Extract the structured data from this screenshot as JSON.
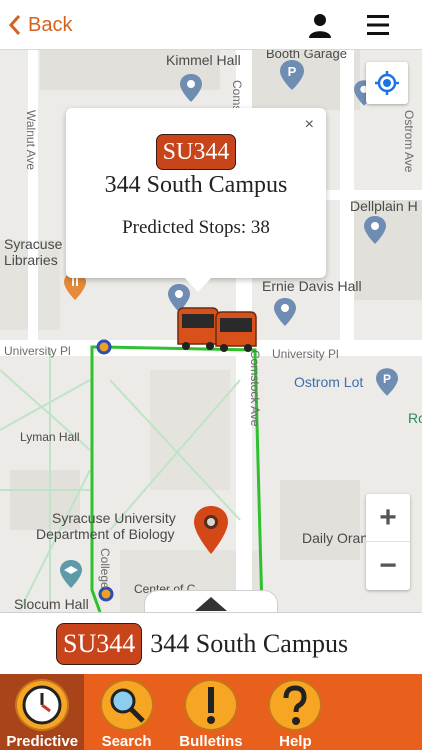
{
  "header": {
    "back_label": "Back"
  },
  "map": {
    "places": {
      "kimmel_hall": "Kimmel Hall",
      "booth_garage": "Booth Garage",
      "dellplain": "Dellplain H",
      "syracuse_libraries_1": "Syracuse",
      "syracuse_libraries_2": "Libraries",
      "ernie_davis": "Ernie Davis Hall",
      "ostrom_lot": "Ostrom Lot",
      "lyman_hall": "Lyman Hall",
      "biology_1": "Syracuse University",
      "biology_2": "Department of Biology",
      "daily_orange": "Daily Oran",
      "slocum_hall": "Slocum Hall",
      "center_of": "Center of C",
      "ro": "Ro"
    },
    "streets": {
      "walnut_ave": "Walnut Ave",
      "university_pl_left": "University Pl",
      "university_pl_right": "University Pl",
      "comstock_ave": "Comstock Ave",
      "comstock_top": "Comstock",
      "ostrom_ave": "Ostrom Ave",
      "college": "College"
    }
  },
  "popup": {
    "badge": "SU344",
    "route_name": "344 South Campus",
    "stops_text": "Predicted Stops: 38",
    "close": "×"
  },
  "route_bar": {
    "badge": "SU344",
    "name": "344 South Campus"
  },
  "tabs": [
    {
      "label": "Predictive",
      "icon": "clock-icon",
      "active": true
    },
    {
      "label": "Search",
      "icon": "magnifier-icon",
      "active": false
    },
    {
      "label": "Bulletins",
      "icon": "exclamation-icon",
      "active": false
    },
    {
      "label": "Help",
      "icon": "question-icon",
      "active": false
    }
  ],
  "zoom": {
    "in": "+",
    "out": "−"
  },
  "colors": {
    "accent": "#e8601c",
    "back": "#d4631f",
    "route_line": "#2ec02e",
    "badge": "#c8441b",
    "tab_circle": "#f6a623"
  }
}
